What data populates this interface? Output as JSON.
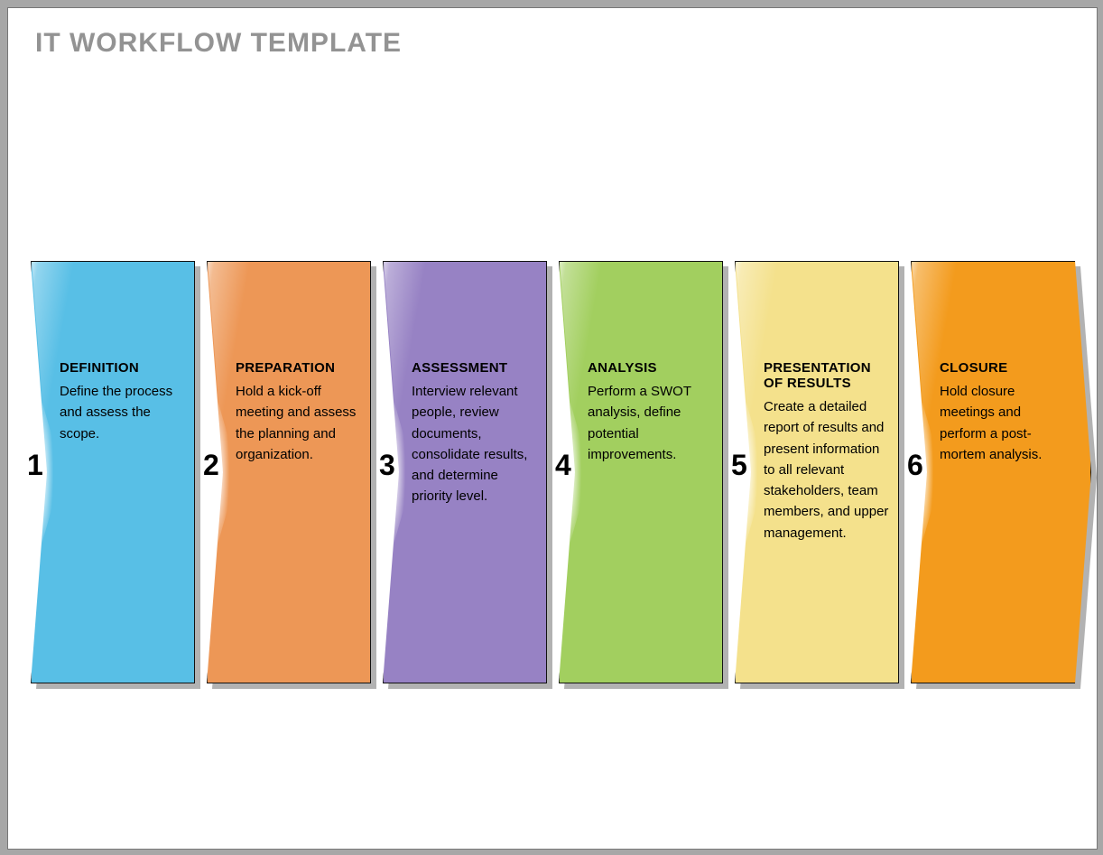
{
  "title": "IT WORKFLOW TEMPLATE",
  "steps": [
    {
      "number": "1",
      "heading": "DEFINITION",
      "desc": "Define the process and assess the scope.",
      "color": "c1"
    },
    {
      "number": "2",
      "heading": "PREPARATION",
      "desc": "Hold a kick-off meeting and assess the planning and organization.",
      "color": "c2"
    },
    {
      "number": "3",
      "heading": "ASSESSMENT",
      "desc": "Interview relevant people, review documents, consolidate results, and determine priority level.",
      "color": "c3"
    },
    {
      "number": "4",
      "heading": "ANALYSIS",
      "desc": "Perform a SWOT analysis, define potential improvements.",
      "color": "c4"
    },
    {
      "number": "5",
      "heading": "PRESENTATION OF RESULTS",
      "desc": "Create a detailed report of results and present information to all relevant stakeholders, team members, and upper management.",
      "color": "c5"
    },
    {
      "number": "6",
      "heading": "CLOSURE",
      "desc": "Hold closure meetings and perform a post-mortem analysis.",
      "color": "c6"
    }
  ]
}
